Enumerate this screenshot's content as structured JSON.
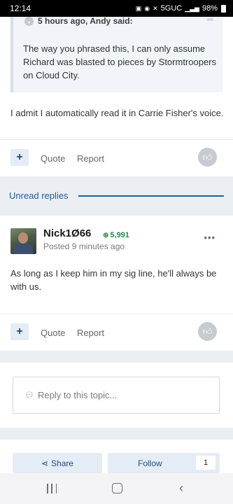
{
  "status_bar": {
    "time": "12:14",
    "network": "5GUC",
    "battery": "98%"
  },
  "post1": {
    "quote_header": "5 hours ago, Andy said:",
    "quote_text": "The way you phrased this, I can only assume Richard was blasted to pieces by Stormtroopers on Cloud City.",
    "body": "I admit I automatically read it in Carrie Fisher's voice.",
    "actions": {
      "plus": "+",
      "quote": "Quote",
      "report": "Report"
    }
  },
  "unread": {
    "label": "Unread replies"
  },
  "post2": {
    "username": "Nick1Ø66",
    "reputation": "5,991",
    "posted": "Posted 9 minutes ago",
    "more": "•••",
    "body": "As long as I keep him in my sig line, he'll always be with us.",
    "actions": {
      "plus": "+",
      "quote": "Quote",
      "report": "Report"
    }
  },
  "reply": {
    "placeholder": "Reply to this topic..."
  },
  "bottom": {
    "share_label": "Share",
    "follow_label": "Follow",
    "follow_count": "1"
  },
  "colors": {
    "accent": "#1f5f99",
    "reputation": "#2f8a4a",
    "button_bg": "#e4ecf5"
  },
  "icons": {
    "quote_chevron": "chevron-down-icon",
    "quote_share": "share-arrow-icon",
    "like": "thumbs-up-icon",
    "reputation": "plus-circle-icon",
    "reply": "speech-bubble-icon",
    "share": "share-nodes-icon"
  }
}
